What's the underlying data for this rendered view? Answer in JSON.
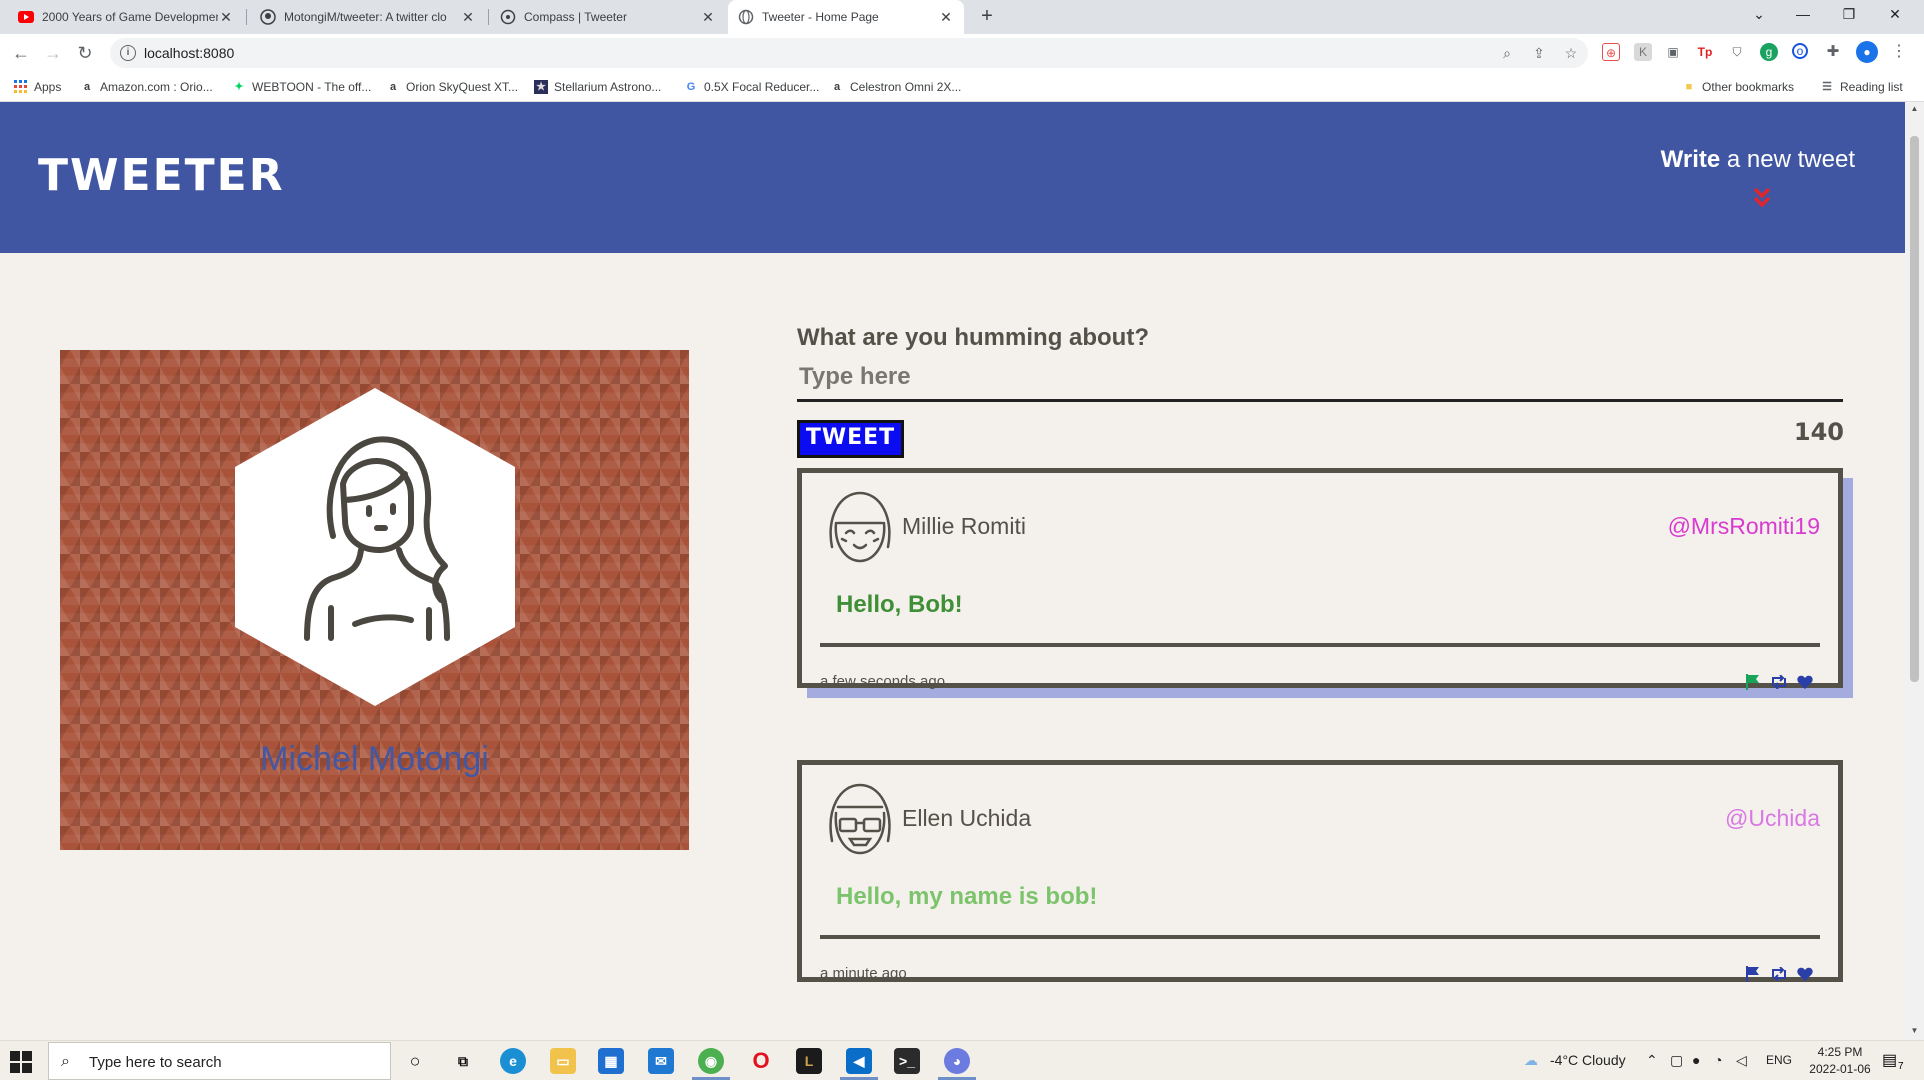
{
  "browser": {
    "tabs": [
      {
        "title": "2000 Years of Game Developmen",
        "icon": "youtube-icon",
        "active": false
      },
      {
        "title": "MotongiM/tweeter: A twitter clo",
        "icon": "github-icon",
        "active": false
      },
      {
        "title": "Compass | Tweeter",
        "icon": "globe-icon",
        "active": false
      },
      {
        "title": "Tweeter - Home Page",
        "icon": "globe-icon",
        "active": true
      }
    ],
    "url": "localhost:8080",
    "bookmarks": [
      {
        "label": "Apps",
        "icon": "apps-grid-icon"
      },
      {
        "label": "Amazon.com : Orio...",
        "icon": "amazon-icon"
      },
      {
        "label": "WEBTOON - The off...",
        "icon": "webtoon-icon"
      },
      {
        "label": "Orion SkyQuest XT...",
        "icon": "amazon-icon"
      },
      {
        "label": "Stellarium Astrono...",
        "icon": "stellarium-icon"
      },
      {
        "label": "0.5X Focal Reducer...",
        "icon": "google-icon"
      },
      {
        "label": "Celestron Omni 2X...",
        "icon": "amazon-icon"
      }
    ],
    "other_bookmarks": "Other bookmarks",
    "reading_list": "Reading list"
  },
  "header": {
    "site_title": "TWEETER",
    "write_bold": "Write",
    "write_rest": " a new tweet"
  },
  "profile": {
    "name": "Michel Motongi"
  },
  "composer": {
    "label": "What are you humming about?",
    "placeholder": "Type here",
    "button_label": "TWEET",
    "counter": "140"
  },
  "tweets": [
    {
      "name": "Millie Romiti",
      "handle": "@MrsRomiti19",
      "text": "Hello, Bob!",
      "time": "a few seconds ago",
      "handle_color": "#d93ad0",
      "text_color": "#3f8f36",
      "flag_color": "#18a25a"
    },
    {
      "name": "Ellen Uchida",
      "handle": "@Uchida",
      "text": "Hello, my name is bob!",
      "time": "a minute ago",
      "handle_color": "#d977e4",
      "text_color": "#7cc46c",
      "flag_color": "#2a3fa8"
    }
  ],
  "colors": {
    "header_bg": "#4056a2",
    "page_bg": "#f4f1ec",
    "profile_bg": "#a9533a",
    "profile_name": "#4457a3",
    "tweet_button": "#0c0cf2",
    "chevron": "#e0262c",
    "heart": "#2a3fa8"
  },
  "taskbar": {
    "search_placeholder": "Type here to search",
    "weather": "-4°C  Cloudy",
    "language": "ENG",
    "time": "4:25 PM",
    "date": "2022-01-06",
    "notification_count": "7"
  }
}
